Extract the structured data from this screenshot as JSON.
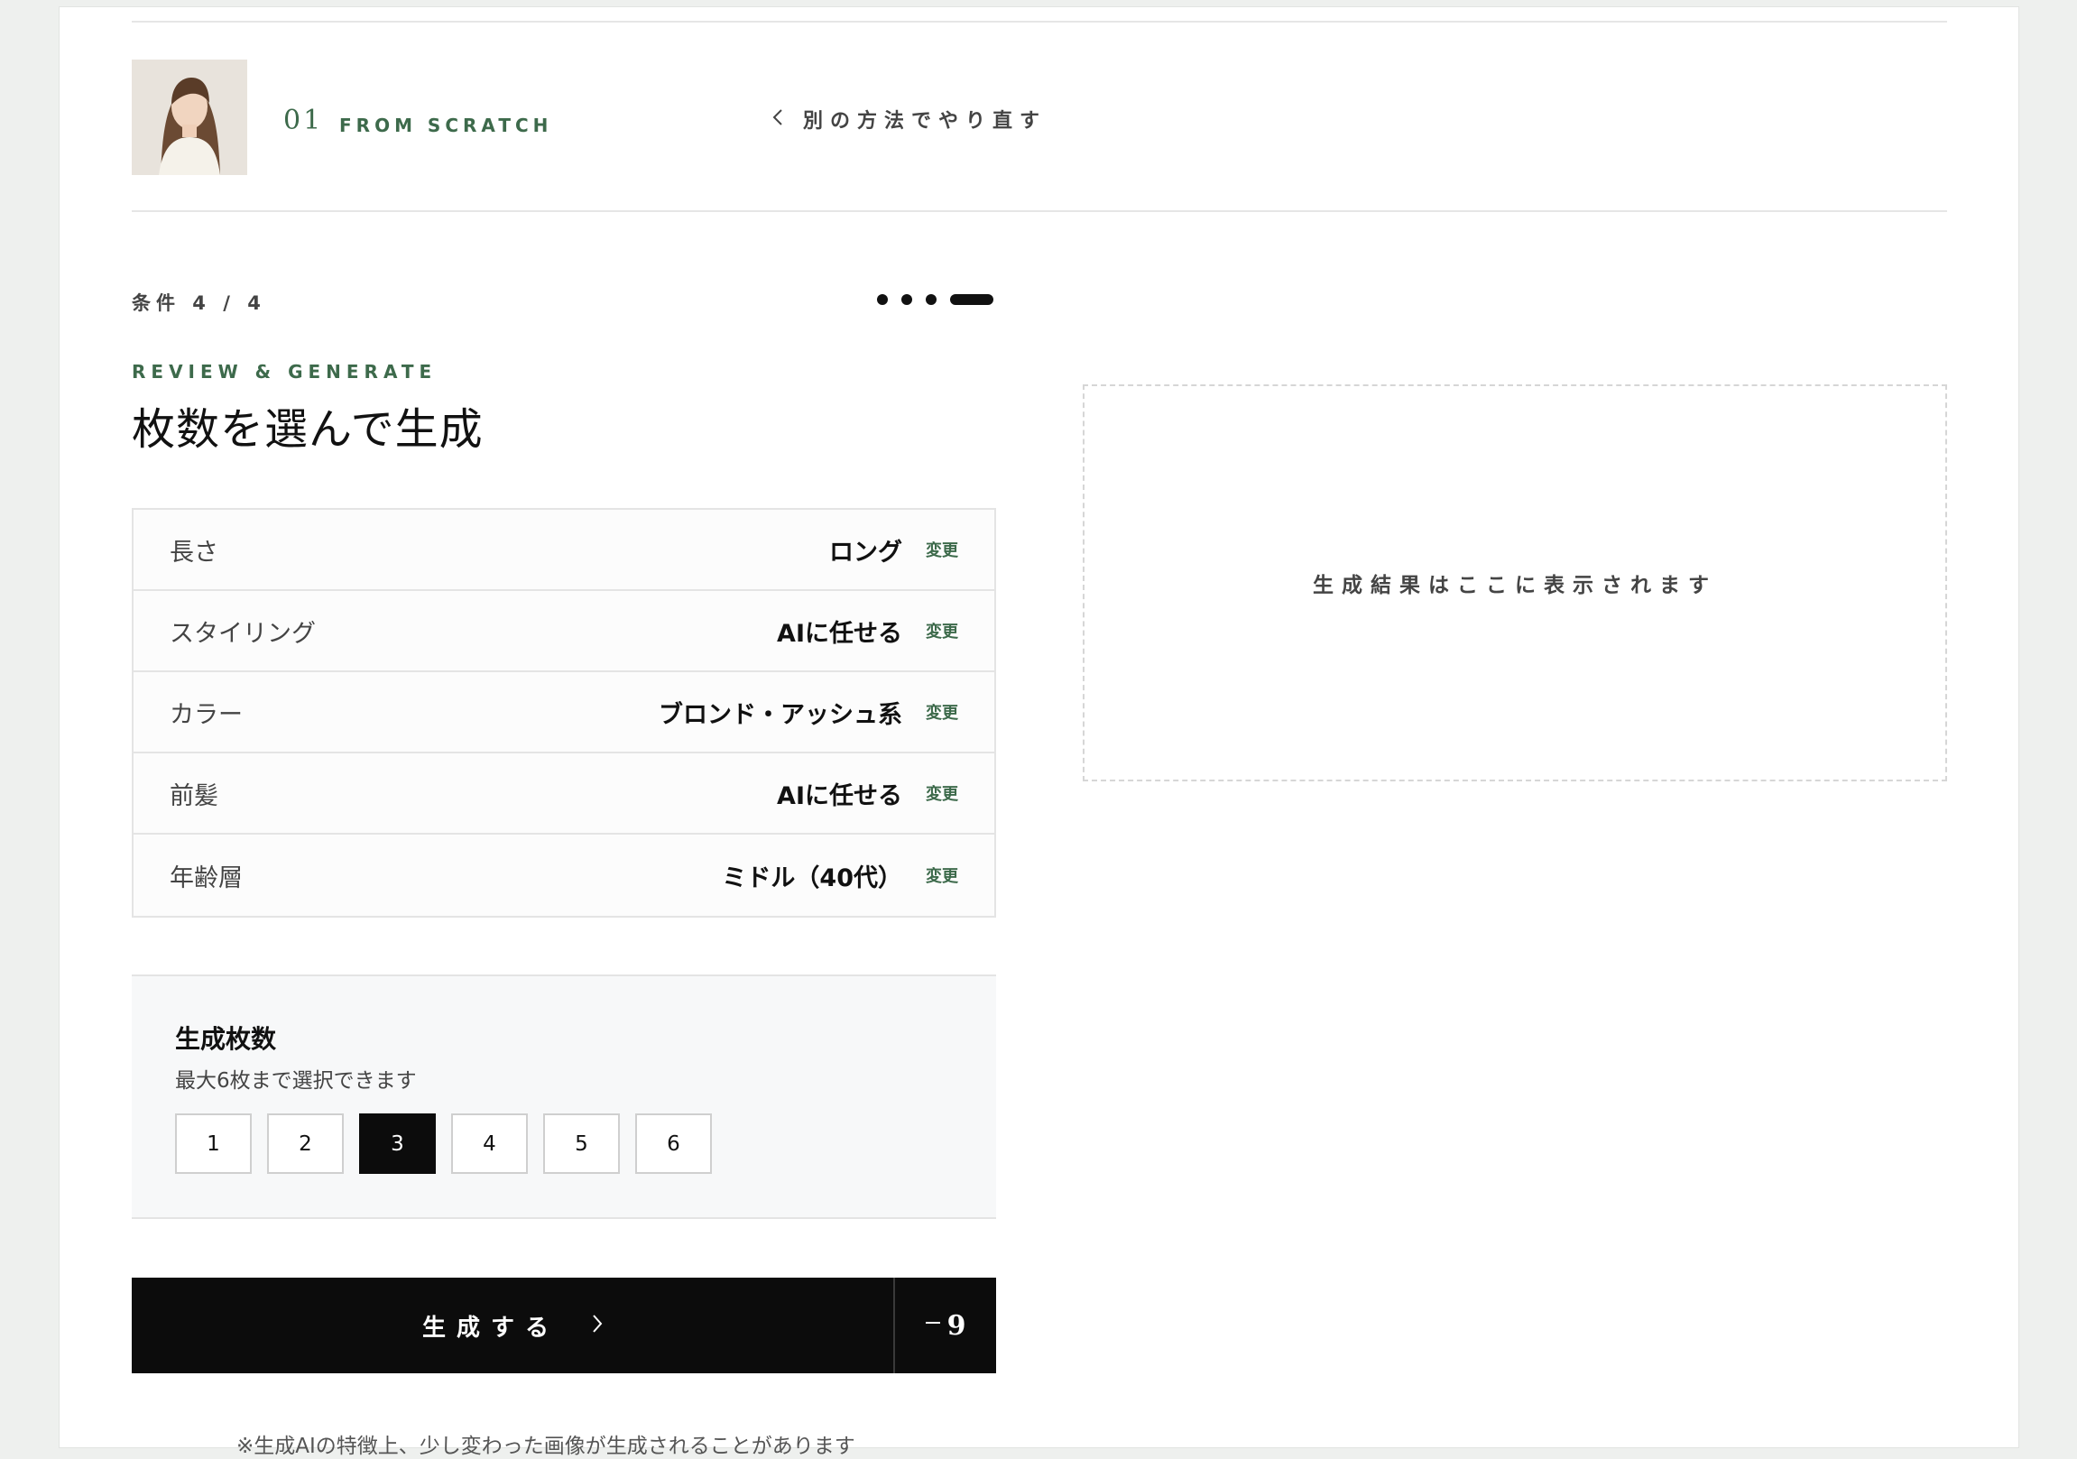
{
  "header": {
    "method_number": "01",
    "method_name": "FROM SCRATCH",
    "back_label": "別の方法でやり直す",
    "icons": {
      "back": "chevron-left-icon",
      "avatar": "avatar-photo"
    }
  },
  "progress": {
    "step_label": "条件 4 / 4",
    "current_step": 4,
    "total_steps": 4
  },
  "section": {
    "eyebrow": "REVIEW & GENERATE",
    "title": "枚数を選んで生成"
  },
  "summary": {
    "change_label": "変更",
    "rows": [
      {
        "label": "長さ",
        "value": "ロング"
      },
      {
        "label": "スタイリング",
        "value": "AIに任せる"
      },
      {
        "label": "カラー",
        "value": "ブロンド・アッシュ系"
      },
      {
        "label": "前髪",
        "value": "AIに任せる"
      },
      {
        "label": "年齢層",
        "value": "ミドル（40代）"
      }
    ]
  },
  "count": {
    "title": "生成枚数",
    "subtitle": "最大6枚まで選択できます",
    "options": [
      "1",
      "2",
      "3",
      "4",
      "5",
      "6"
    ],
    "selected": "3"
  },
  "generate": {
    "label": "生成する",
    "cost": "9",
    "icons": {
      "arrow": "chevron-right-icon",
      "cost": "minus-icon"
    }
  },
  "note": "※生成AIの特徴上、少し変わった画像が生成されることがあります",
  "result": {
    "placeholder": "生成結果はここに表示されます"
  },
  "colors": {
    "accent": "#3d6a4b",
    "dark": "#0c0c0c",
    "background": "#eef0ee"
  }
}
